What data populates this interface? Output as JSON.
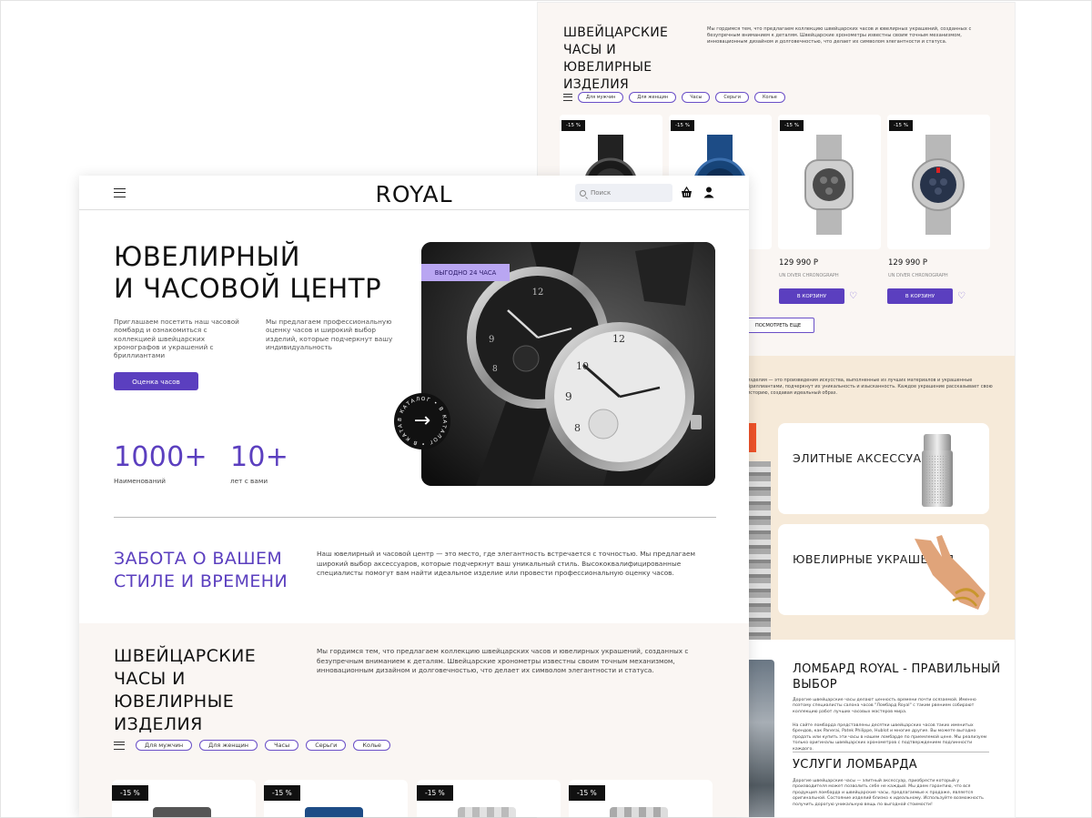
{
  "back": {
    "title": "ШВЕЙЦАРСКИЕ ЧАСЫ И ЮВЕЛИРНЫЕ ИЗДЕЛИЯ",
    "description": "Мы гордимся тем, что предлагаем коллекцию швейцарских часов и ювелирных украшений, созданных с безупречным вниманием к деталям. Швейцарские хронометры известны своим точным механизмом, инновационным дизайном и долговечностью, что делает их символом элегантности и статуса.",
    "filters": [
      "Для мужчин",
      "Для женщин",
      "Часы",
      "Серьги",
      "Колье"
    ],
    "cards": [
      {
        "discount": "-15 %"
      },
      {
        "discount": "-15 %"
      },
      {
        "discount": "-15 %",
        "price": "129 990 Р",
        "name": "UN DIVER CHRONOGRAPH",
        "cart": "В КОРЗИНУ"
      },
      {
        "discount": "-15 %",
        "price": "129 990 Р",
        "name": "UN DIVER CHRONOGRAPH",
        "cart": "В КОРЗИНУ"
      }
    ],
    "more_button": "ПОСМОТРЕТЬ ЕЩЕ",
    "mid_text": "изделия — это произведения искусства, выполненные из лучших материалов и украшенные бриллиантами, подчеркнут их уникальность и изысканность. Каждое украшение рассказывает свою историю, создавая идеальный образ.",
    "categories": [
      {
        "title": "ЭЛИТНЫЕ АКСЕССУАРЫ"
      },
      {
        "title": "ЮВЕЛИРНЫЕ УКРАШЕНИЯ"
      }
    ],
    "pawn_title": "ЛОМБАРД ROYAL - ПРАВИЛЬНЫЙ ВЫБОР",
    "pawn_p1": "Дорогие швейцарские часы делают ценность времени почти осязаемой. Именно поэтому специалисты салона часов \"Ломбард Royal\" с таким рвением собирают коллекцию работ лучших часовых мастеров мира.",
    "pawn_p2": "На сайте ломбарда представлены десятки швейцарских часов таких именитых брендов, как Panerai, Patek Philippe, Hublot и многие другие. Вы можете выгодно продать или купить эти часы в нашем ломбарде по приемлемой цене. Мы реализуем только оригиналы швейцарских хронометров с подтверждением подлинности каждого.",
    "services_title": "УСЛУГИ ЛОМБАРДА",
    "services_p": "Дорогие швейцарские часы — элитный аксессуар, приобрести который у производителя может позволить себе не каждый. Мы даем гарантию, что вся продукция ломбарда и швейцарские часы, предлагаемые к продаже, является оригинальной. Состояние изделий близко к идеальному. Используйте возможность получить дорогую уникальную вещь по выгодной стоимости!"
  },
  "header": {
    "logo": "ROYAL",
    "search_placeholder": "Поиск"
  },
  "hero": {
    "title_line1": "ЮВЕЛИРНЫЙ",
    "title_line2": "И ЧАСОВОЙ ЦЕНТР",
    "intro_left": "Приглашаем посетить наш часовой ломбард и ознакомиться с коллекцией швейцарских хронографов и украшений с бриллиантами",
    "intro_right": "Мы предлагаем профессиональную оценку часов и широкий выбор изделий, которые подчеркнут вашу индивидуальность",
    "cta": "Оценка часов",
    "badge": "ВЫГОДНО 24 ЧАСА",
    "catalog_ring": "В КАТАЛОГ • В КАТАЛОГ • В КАТАЛОГ •",
    "stats": [
      {
        "value": "1000+",
        "label": "Наименований"
      },
      {
        "value": "10+",
        "label": "лет с вами"
      }
    ]
  },
  "care": {
    "title": "ЗАБОТА О ВАШЕМ СТИЛЕ И ВРЕМЕНИ",
    "text": "Наш ювелирный и часовой центр — это место, где элегантность встречается с точностью. Мы предлагаем широкий выбор аксессуаров, которые подчеркнут ваш уникальный стиль. Высококвалифицированные специалисты помогут вам найти идеальное изделие или провести профессиональную оценку часов."
  },
  "swiss": {
    "title": "ШВЕЙЦАРСКИЕ ЧАСЫ И ЮВЕЛИРНЫЕ ИЗДЕЛИЯ",
    "text": "Мы гордимся тем, что предлагаем коллекцию швейцарских часов и ювелирных украшений, созданных с безупречным вниманием к деталям. Швейцарские хронометры известны своим точным механизмом, инновационным дизайном и долговечностью, что делает их символом элегантности и статуса.",
    "filters": [
      "Для мужчин",
      "Для женщин",
      "Часы",
      "Серьги",
      "Колье"
    ],
    "discounts": [
      "-15 %",
      "-15 %",
      "-15 %",
      "-15 %"
    ]
  },
  "colors": {
    "accent": "#5b3fbf",
    "badge": "#b9a6f2",
    "beige": "#faf6f3",
    "sand": "#f6ead9",
    "orange": "#f0532a"
  }
}
